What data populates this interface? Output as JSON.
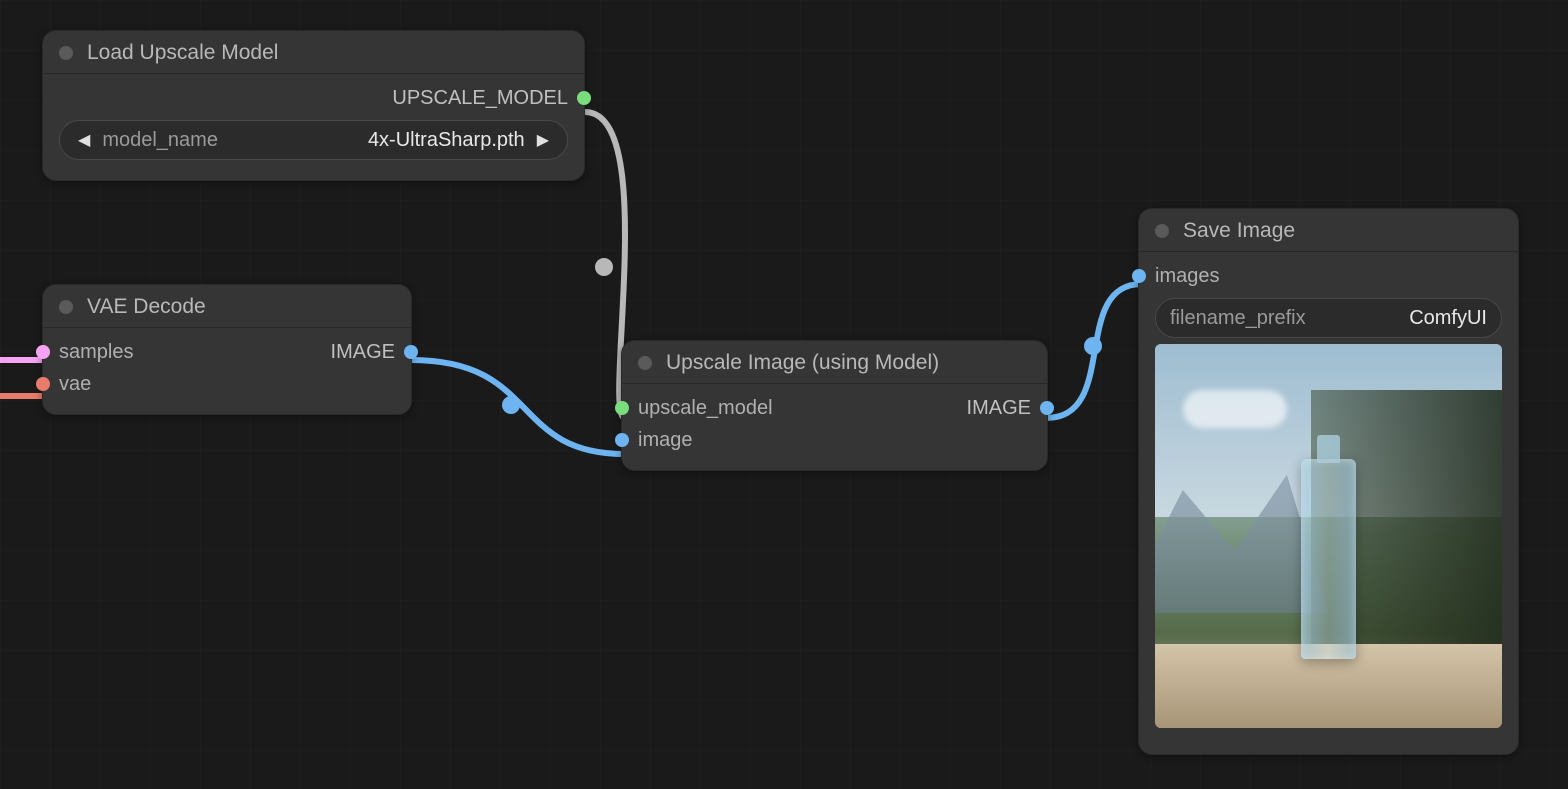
{
  "nodes": {
    "load_upscale_model": {
      "title": "Load Upscale Model",
      "outputs": {
        "upscale_model": "UPSCALE_MODEL"
      },
      "widgets": {
        "model_name": {
          "label": "model_name",
          "value": "4x-UltraSharp.pth"
        }
      }
    },
    "vae_decode": {
      "title": "VAE Decode",
      "inputs": {
        "samples": "samples",
        "vae": "vae"
      },
      "outputs": {
        "image": "IMAGE"
      }
    },
    "upscale_image": {
      "title": "Upscale Image (using Model)",
      "inputs": {
        "upscale_model": "upscale_model",
        "image": "image"
      },
      "outputs": {
        "image": "IMAGE"
      }
    },
    "save_image": {
      "title": "Save Image",
      "inputs": {
        "images": "images"
      },
      "widgets": {
        "filename_prefix": {
          "label": "filename_prefix",
          "value": "ComfyUI"
        }
      }
    }
  },
  "colors": {
    "port_upscale_model": "#7bdc7b",
    "port_latent": "#f5a3f5",
    "port_vae": "#e87c6a",
    "port_image": "#6db4f0"
  }
}
